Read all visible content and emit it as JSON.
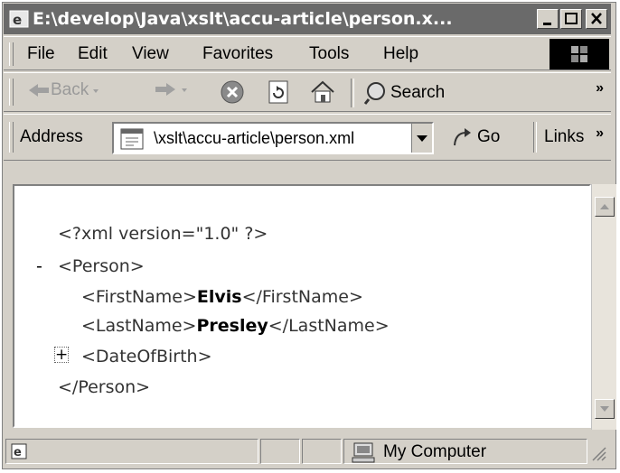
{
  "window": {
    "title": "E:\\develop\\Java\\xslt\\accu-article\\person.x..."
  },
  "menu": [
    {
      "label": "File"
    },
    {
      "label": "Edit"
    },
    {
      "label": "View"
    },
    {
      "label": "Favorites"
    },
    {
      "label": "Tools"
    },
    {
      "label": "Help"
    }
  ],
  "toolbar": {
    "back_label": "Back",
    "search_label": "Search"
  },
  "address": {
    "label": "Address",
    "value": "\\xslt\\accu-article\\person.xml",
    "go_label": "Go",
    "links_label": "Links"
  },
  "document": {
    "lines": [
      {
        "prefix": "",
        "text": "<?xml version=\"1.0\" ?>"
      },
      {
        "prefix": "-",
        "text": "<Person>"
      },
      {
        "open": "<FirstName>",
        "value": "Elvis",
        "close": "</FirstName>"
      },
      {
        "open": "<LastName>",
        "value": "Presley",
        "close": "</LastName>"
      },
      {
        "prefix": "+",
        "text": "<DateOfBirth>"
      },
      {
        "prefix": "",
        "text": "</Person>"
      }
    ]
  },
  "status": {
    "zone": "My Computer"
  }
}
